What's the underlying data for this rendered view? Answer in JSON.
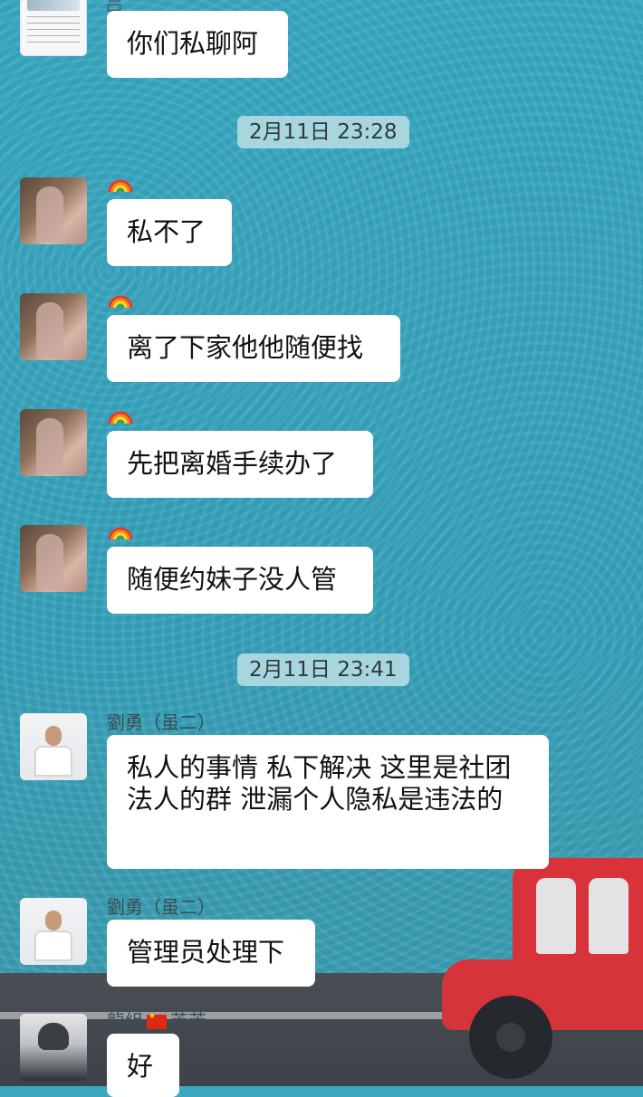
{
  "top_name": "吕",
  "timestamps": [
    "2月11日 23:28",
    "2月11日 23:41"
  ],
  "messages": [
    {
      "sender": "",
      "text": "你们私聊阿"
    },
    {
      "sender": "rainbow",
      "text": "私不了"
    },
    {
      "sender": "rainbow",
      "text": "离了下家他他随便找"
    },
    {
      "sender": "rainbow",
      "text": "先把离婚手续办了"
    },
    {
      "sender": "rainbow",
      "text": "随便约妹子没人管"
    },
    {
      "sender": "劉勇（虽二）",
      "text": "私人的事情 私下解决 这里是社团法人的群 泄漏个人隐私是违法的"
    },
    {
      "sender": "劉勇（虽二）",
      "text": "管理员处理下"
    },
    {
      "sender_prefix": "龍組",
      "sender_suffix": "芳芳",
      "text": "好"
    }
  ],
  "colors": {
    "background": "#3aa7be",
    "bubble": "#ffffff",
    "time_pill": "#a7d6df",
    "car_red": "#d6343b"
  },
  "icons": [
    "rainbow-emoji",
    "china-flag-emoji"
  ]
}
